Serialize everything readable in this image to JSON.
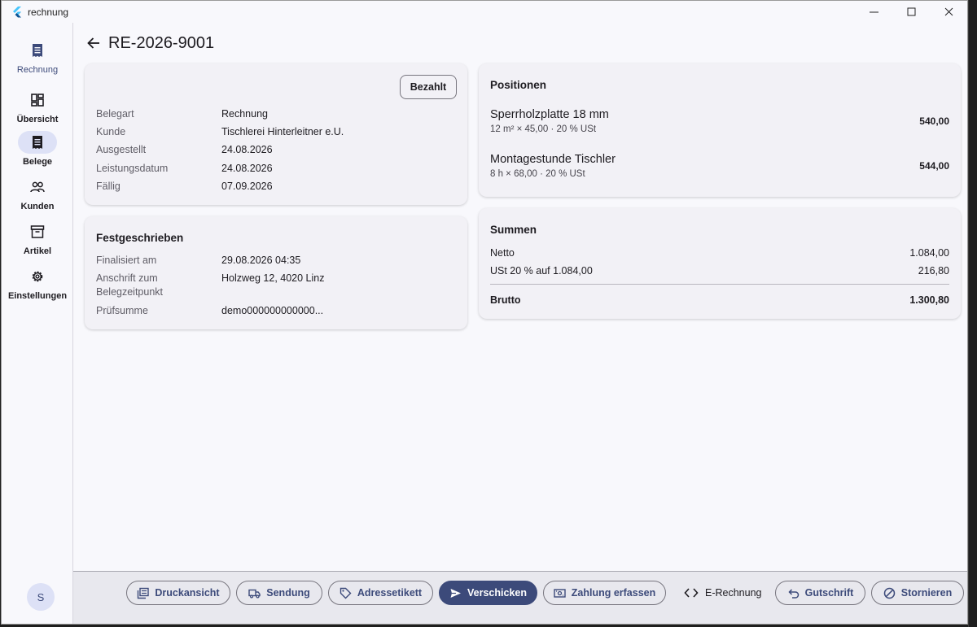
{
  "window": {
    "title": "rechnung"
  },
  "rail": {
    "brand_label": "Rechnung",
    "items": [
      {
        "label": "Übersicht",
        "icon": "dashboard-icon"
      },
      {
        "label": "Belege",
        "icon": "receipt-icon",
        "active": true
      },
      {
        "label": "Kunden",
        "icon": "people-icon"
      },
      {
        "label": "Artikel",
        "icon": "archive-icon"
      },
      {
        "label": "Einstellungen",
        "icon": "gear-icon"
      }
    ],
    "avatar_initial": "S"
  },
  "header": {
    "title": "RE-2026-9001"
  },
  "details": {
    "status_button": "Bezahlt",
    "rows": [
      {
        "label": "Belegart",
        "value": "Rechnung"
      },
      {
        "label": "Kunde",
        "value": "Tischlerei Hinterleitner e.U."
      },
      {
        "label": "Ausgestellt",
        "value": "24.08.2026"
      },
      {
        "label": "Leistungsdatum",
        "value": "24.08.2026"
      },
      {
        "label": "Fällig",
        "value": "07.09.2026"
      }
    ]
  },
  "finalized": {
    "title": "Festgeschrieben",
    "rows": [
      {
        "label": "Finalisiert am",
        "value": "29.08.2026 04:35"
      },
      {
        "label": "Anschrift zum Belegzeitpunkt",
        "value": "Holzweg 12, 4020 Linz"
      },
      {
        "label": "Prüfsumme",
        "value": "demo000000000000..."
      }
    ]
  },
  "positions": {
    "title": "Positionen",
    "items": [
      {
        "name": "Sperrholzplatte 18 mm",
        "detail": "12 m² × 45,00 · 20 % USt",
        "amount": "540,00"
      },
      {
        "name": "Montagestunde Tischler",
        "detail": "8 h × 68,00 · 20 % USt",
        "amount": "544,00"
      }
    ]
  },
  "sums": {
    "title": "Summen",
    "netto_label": "Netto",
    "netto_value": "1.084,00",
    "ust_label": "USt 20 % auf 1.084,00",
    "ust_value": "216,80",
    "brutto_label": "Brutto",
    "brutto_value": "1.300,80"
  },
  "actions": {
    "druckansicht": "Druckansicht",
    "sendung": "Sendung",
    "adressetikett": "Adressetikett",
    "verschicken": "Verschicken",
    "zahlung": "Zahlung erfassen",
    "erechnung": "E-Rechnung",
    "gutschrift": "Gutschrift",
    "stornieren": "Stornieren"
  },
  "colors": {
    "primary": "#3c4a7a",
    "active_pill": "#dde1f6",
    "card": "#f2f1f6",
    "background": "#f8f8fc"
  }
}
